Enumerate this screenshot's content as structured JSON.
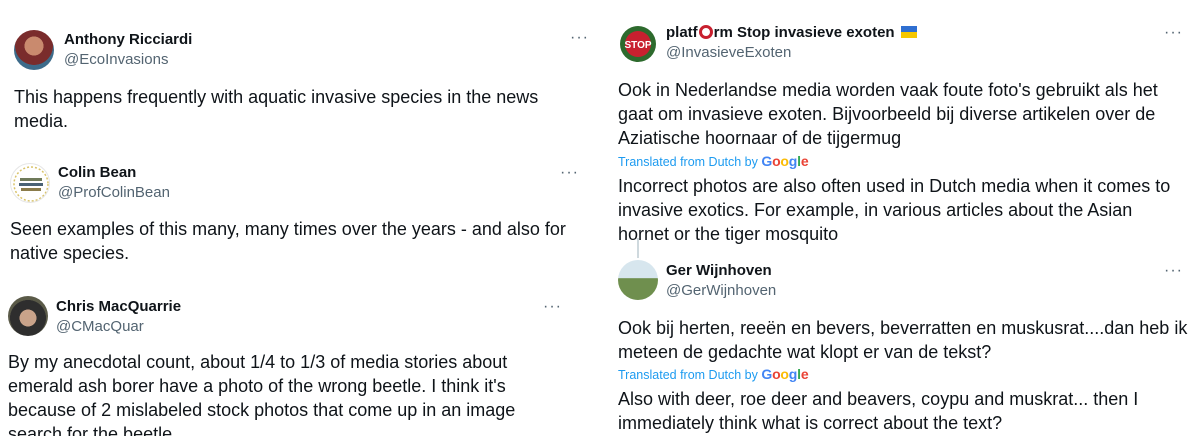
{
  "left_column": {
    "tweets": [
      {
        "name": "Anthony Ricciardi",
        "handle": "@EcoInvasions",
        "text": "This happens frequently with aquatic invasive species in the news media."
      },
      {
        "name": "Colin Bean",
        "handle": "@ProfColinBean",
        "text": "Seen examples of this many, many times over the years - and also for native species."
      },
      {
        "name": "Chris MacQuarrie",
        "handle": "@CMacQuar",
        "text": "By my anecdotal count, about 1/4 to 1/3 of media stories about emerald ash borer have a photo of the wrong beetle. I think it's because of 2 mislabeled stock photos that come up in an image search for the beetle."
      }
    ]
  },
  "right_column": {
    "tweets": [
      {
        "name_prefix": "platf",
        "name_suffix": "rm Stop invasieve exoten",
        "handle": "@InvasieveExoten",
        "original_text": "Ook in Nederlandse media worden vaak foute foto's gebruikt als het gaat om invasieve exoten. Bijvoorbeeld bij diverse artikelen over de Aziatische hoornaar of de tijgermug",
        "translated_label": "Translated from Dutch by",
        "translated_text": "Incorrect photos are also often used in Dutch media when it comes to invasive exotics. For example, in various articles about the Asian hornet or the tiger mosquito"
      },
      {
        "name": "Ger Wijnhoven",
        "handle": "@GerWijnhoven",
        "original_text": "Ook bij herten, reeën en bevers, beverratten en muskusrat....dan heb ik meteen de gedachte wat klopt er van de tekst?",
        "translated_label": "Translated from Dutch by",
        "translated_text": "Also with deer, roe deer and beavers, coypu and muskrat... then I immediately think what is correct about the text?"
      }
    ]
  },
  "more_icon_glyph": "···",
  "google_logo": [
    "G",
    "o",
    "o",
    "g",
    "l",
    "e"
  ],
  "colors": {
    "text": "#0f1419",
    "secondary": "#536471",
    "link": "#1d9bf0",
    "google_blue": "#4285f4",
    "google_red": "#ea4335",
    "google_yellow": "#fbbc05",
    "google_green": "#34a853",
    "stop_red": "#c8202f"
  },
  "icons": [
    "more-icon",
    "ukraine-flag-icon",
    "google-logo",
    "stop-logo",
    "avatar"
  ]
}
